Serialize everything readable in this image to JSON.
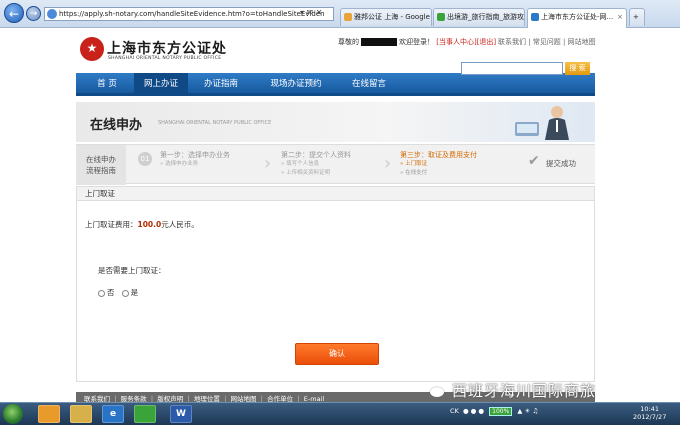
{
  "browser": {
    "address": "https://apply.sh-notary.com/handleSiteEvidence.htm?o=toHandleSiteEviden",
    "tabs": [
      {
        "label": "雅邦公证 上海 - Google ...",
        "icon_color": "#e8a33a"
      },
      {
        "label": "出境游_旅行指南_旅游攻...",
        "icon_color": "#3aa33a"
      },
      {
        "label": "上海市东方公证处-网...",
        "icon_color": "#2a7ac8",
        "active": true
      }
    ]
  },
  "header": {
    "logo_cn": "上海市东方公证处",
    "logo_en": "SHANGHAI ORIENTAL NOTARY PUBLIC OFFICE",
    "greeting_prefix": "尊敬的",
    "greeting_suffix": "欢迎登录！",
    "user_center": "[当事人中心]",
    "logout": "[退出]",
    "links": [
      "联系我们",
      "常见问题",
      "网站地图"
    ]
  },
  "nav": {
    "items": [
      "首 页",
      "网上办证",
      "办证指南",
      "现场办证预约",
      "在线留言"
    ],
    "active_index": 1,
    "search_button": "搜 索"
  },
  "banner": {
    "title": "在线申办",
    "subtitle": "SHANGHAI ORIENTAL NOTARY PUBLIC OFFICE"
  },
  "steps": {
    "label_line1": "在线申办",
    "label_line2": "流程指南",
    "step_number": "01",
    "step1_title": "第一步：选择申办业务",
    "step1_sub": "» 选择申办业务",
    "step2_title": "第二步：提交个人资料",
    "step2_sub1": "» 填写个人信息",
    "step2_sub2": "» 上传相关资料证明",
    "step3_title": "第三步：取证及费用支付",
    "step3_sub1": "» 上门取证",
    "step3_sub2": "» 在线支付",
    "done": "提交成功"
  },
  "content": {
    "section_title": "上门取证",
    "fee_label": "上门取证费用：",
    "fee_amount": "100.0",
    "fee_unit": "元人民币。",
    "question": "是否需要上门取证：",
    "option_no": "否",
    "option_yes": "是",
    "confirm": "确认"
  },
  "footer": {
    "links": "联系我们 ｜ 服务条款 ｜ 版权声明 ｜ 地理位置 ｜ 网站地图 ｜ 合作单位 ｜ E-mail"
  },
  "watermark": "西班牙海川国际商旅",
  "taskbar": {
    "apps": [
      "",
      "",
      "e",
      "",
      "W"
    ],
    "tray_lang": "CK",
    "battery": "100%",
    "time": "10:41",
    "date": "2012/7/27"
  }
}
